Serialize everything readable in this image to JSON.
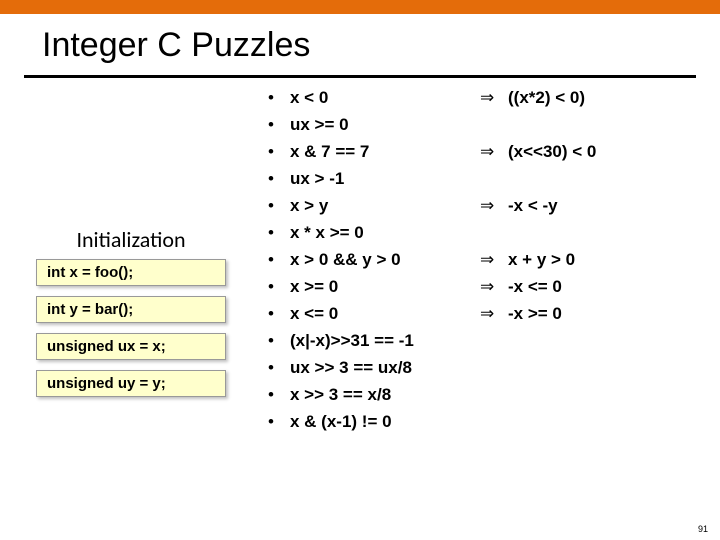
{
  "header": {
    "title": "Integer C Puzzles"
  },
  "init": {
    "heading": "Initialization",
    "lines": [
      "int x = foo();",
      "int y = bar();",
      "unsigned ux = x;",
      "unsigned uy = y;"
    ]
  },
  "puzzles": [
    {
      "lhs": "x < 0",
      "rhs": "((x*2) < 0)"
    },
    {
      "lhs": "ux >= 0",
      "rhs": ""
    },
    {
      "lhs": "x & 7 == 7",
      "rhs": "(x<<30) < 0"
    },
    {
      "lhs": "ux > -1",
      "rhs": ""
    },
    {
      "lhs": "x > y",
      "rhs": "-x < -y"
    },
    {
      "lhs": "x * x >= 0",
      "rhs": ""
    },
    {
      "lhs": "x > 0 && y > 0",
      "rhs": "x + y > 0"
    },
    {
      "lhs": "x >= 0",
      "rhs": "-x <= 0"
    },
    {
      "lhs": "x <= 0",
      "rhs": "-x >= 0"
    },
    {
      "lhs": "(x|-x)>>31 == -1",
      "rhs": ""
    },
    {
      "lhs": "ux >> 3 == ux/8",
      "rhs": ""
    },
    {
      "lhs": "x >> 3 == x/8",
      "rhs": ""
    },
    {
      "lhs": "x & (x-1) != 0",
      "rhs": ""
    }
  ],
  "bullet": "•",
  "implies": "⇒",
  "page_number": "91"
}
